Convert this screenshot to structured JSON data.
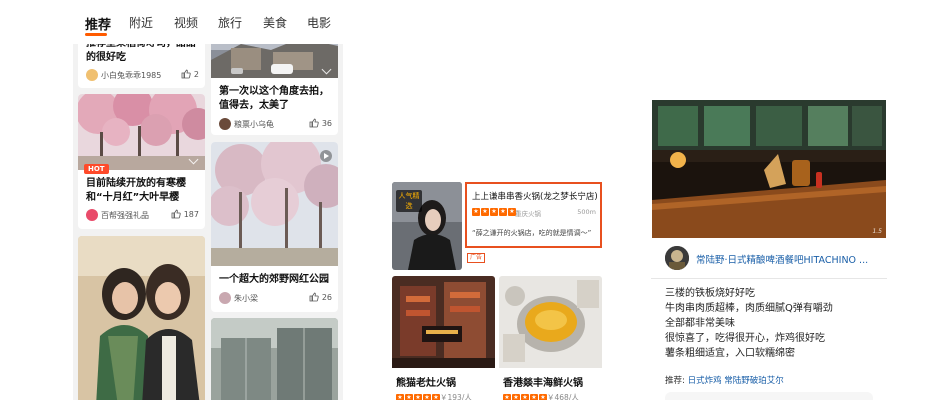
{
  "feed": {
    "tabs": [
      "推荐",
      "附近",
      "视频",
      "旅行",
      "美食",
      "电影"
    ],
    "active_tab": "推荐",
    "cards": [
      {
        "title": "推荐坚果稻荷寿司，甜甜的很好吃",
        "author": "小白兔乖乖1985",
        "likes": "2"
      },
      {
        "title": "第一次以这个角度去拍，值得去，太美了",
        "author": "粮票小乌龟",
        "likes": "36"
      },
      {
        "badge": "HOT",
        "title": "目前陆续开放的有寒樱和“十月红”大叶早樱",
        "author": "百帮强强礼品",
        "likes": "187"
      },
      {
        "title": "一个超大的郊野网红公园",
        "author": "朱小梁",
        "likes": "26"
      }
    ]
  },
  "food": {
    "pick_badge": "人气精选",
    "recommend": {
      "name": "上上谦串串香火锅(龙之梦长宁店)",
      "city": "重庆火锅",
      "distance": "500m",
      "quote": "“薛之谦开的火锅店，吃的就是情调～”",
      "rating": 5
    },
    "ad_label": "广告",
    "shops": [
      {
        "name": "熊猫老灶火锅",
        "price": "￥193/人",
        "rating": 5
      },
      {
        "name": "香港燚丰海鲜火锅",
        "price": "￥468/人",
        "rating": 5
      }
    ]
  },
  "post": {
    "author": "常陆野·日式精酿啤酒餐吧HITACHINO ...",
    "lines": [
      "三楼的铁板烧好好吃",
      "牛肉串肉质超棒，肉质细腻Q弹有嚼劲",
      "全部都非常美味",
      "很惊喜了，吃得很开心，炸鸡很好吃",
      "薯条粗细适宜，入口软糯绵密"
    ],
    "tags_label": "推荐:",
    "tags": [
      "日式炸鸡",
      "常陆野破珀艾尔"
    ],
    "watermark": "1.5"
  },
  "colors": {
    "accent": "#ff5b00",
    "highlight_border": "#e8501f",
    "link": "#1a5fa8",
    "star": "#ff6a00"
  }
}
